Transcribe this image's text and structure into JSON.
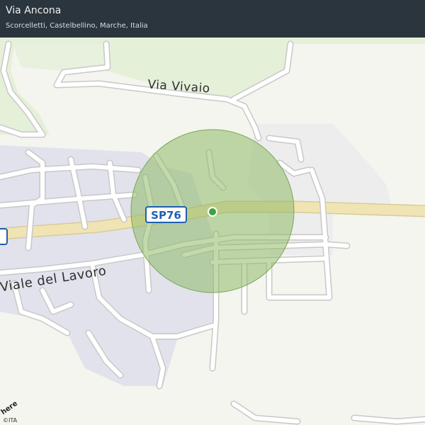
{
  "header": {
    "title": "Via Ancona",
    "subtitle": "Scorcelletti, Castelbellino, Marche, Italia"
  },
  "map": {
    "streets": {
      "via_vivaio": "Via  Vivaio",
      "viale_del_lavoro": "Viale  del  Lavoro"
    },
    "road_shield": "SP76",
    "logo": "here",
    "attribution": "©ITA",
    "colors": {
      "land": "#f3f5ee",
      "green_area": "#e5f0d8",
      "urban_area": "#e1e2ec",
      "accuracy_circle": "#8fba67",
      "location_dot": "#3aa63a",
      "main_road": "#f1e4b4"
    }
  }
}
